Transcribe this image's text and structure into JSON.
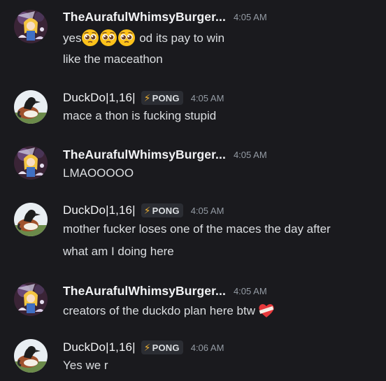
{
  "users": {
    "aura": {
      "name": "TheAurafulWhimsyBurger..."
    },
    "duck": {
      "name": "DuckDo|1,16|",
      "tag": "PONG"
    }
  },
  "messages": [
    {
      "time": "4:05 AM",
      "lines": [
        "yes",
        "od its pay to win",
        "like the maceathon"
      ]
    },
    {
      "time": "4:05 AM",
      "lines": [
        "mace a thon is fucking stupid"
      ]
    },
    {
      "time": "4:05 AM",
      "lines": [
        "LMAOOOOO"
      ]
    },
    {
      "time": "4:05 AM",
      "lines": [
        "mother fucker loses one of the maces the day after",
        "what am I doing here"
      ]
    },
    {
      "time": "4:05 AM",
      "lines": [
        "creators of the duckdo plan here btw"
      ]
    },
    {
      "time": "4:06 AM",
      "lines": [
        "Yes we r"
      ]
    }
  ],
  "icons": {
    "pleading_face": "pleading-face-emoji",
    "mending_heart": "mending-heart-emoji",
    "bolt": "⚡"
  },
  "colors": {
    "background": "#1a1a1e",
    "text": "#dbdee1",
    "username": "#f2f3f5",
    "timestamp": "#949ba4",
    "tag_bg": "#2b2d33",
    "bolt": "#f0b232"
  }
}
